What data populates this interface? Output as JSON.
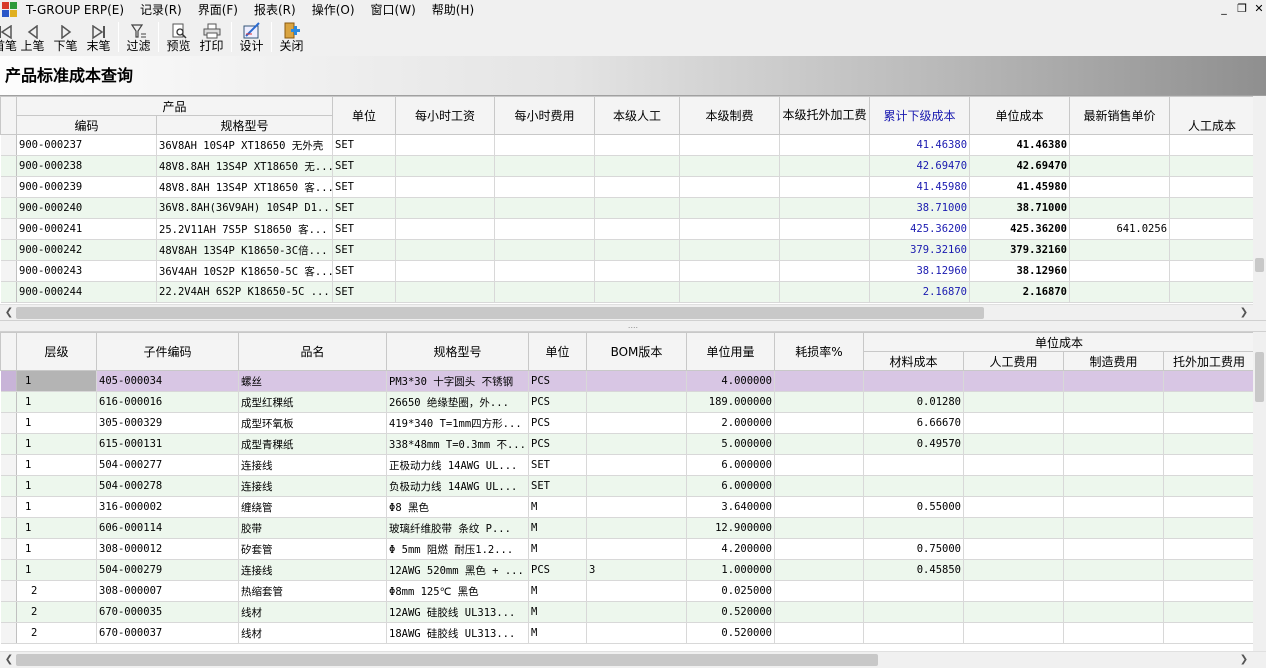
{
  "menubar": {
    "app": "T-GROUP ERP(E)",
    "items": [
      "记录(R)",
      "界面(F)",
      "报表(R)",
      "操作(O)",
      "窗口(W)",
      "帮助(H)"
    ],
    "minimize": "_",
    "restore": "❐",
    "close": "✕"
  },
  "toolbar": {
    "buttons": [
      {
        "label": "首笔",
        "icon": "first-record-icon"
      },
      {
        "label": "上笔",
        "icon": "prev-record-icon"
      },
      {
        "label": "下笔",
        "icon": "next-record-icon"
      },
      {
        "label": "末笔",
        "icon": "last-record-icon"
      },
      {
        "label": "过滤",
        "icon": "filter-icon"
      },
      {
        "label": "预览",
        "icon": "preview-icon"
      },
      {
        "label": "打印",
        "icon": "print-icon"
      },
      {
        "label": "设计",
        "icon": "design-icon"
      },
      {
        "label": "关闭",
        "icon": "close-window-icon"
      }
    ]
  },
  "page": {
    "title": "产品标准成本查询"
  },
  "upper": {
    "group_header": "产品",
    "columns": [
      "编码",
      "规格型号",
      "单位",
      "每小时工资",
      "每小时费用",
      "本级人工",
      "本级制费",
      "本级托外加工费",
      "累计下级成本",
      "单位成本",
      "最新销售单价",
      "人工成本"
    ],
    "rows": [
      [
        "900-000237",
        "36V8AH 10S4P XT18650 无外壳",
        "SET",
        "",
        "",
        "",
        "",
        "",
        "41.46380",
        "41.46380",
        "",
        ""
      ],
      [
        "900-000238",
        "48V8.8AH 13S4P XT18650 无...",
        "SET",
        "",
        "",
        "",
        "",
        "",
        "42.69470",
        "42.69470",
        "",
        ""
      ],
      [
        "900-000239",
        "48V8.8AH 13S4P XT18650 客...",
        "SET",
        "",
        "",
        "",
        "",
        "",
        "41.45980",
        "41.45980",
        "",
        ""
      ],
      [
        "900-000240",
        "36V8.8AH(36V9AH) 10S4P D1...",
        "SET",
        "",
        "",
        "",
        "",
        "",
        "38.71000",
        "38.71000",
        "",
        ""
      ],
      [
        "900-000241",
        "25.2V11AH 7S5P S18650 客...",
        "SET",
        "",
        "",
        "",
        "",
        "",
        "425.36200",
        "425.36200",
        "641.0256",
        ""
      ],
      [
        "900-000242",
        "48V8AH 13S4P K18650-3C倍...",
        "SET",
        "",
        "",
        "",
        "",
        "",
        "379.32160",
        "379.32160",
        "",
        ""
      ],
      [
        "900-000243",
        "36V4AH 10S2P K18650-5C 客...",
        "SET",
        "",
        "",
        "",
        "",
        "",
        "38.12960",
        "38.12960",
        "",
        ""
      ],
      [
        "900-000244",
        "22.2V4AH 6S2P K18650-5C ...",
        "SET",
        "",
        "",
        "",
        "",
        "",
        "2.16870",
        "2.16870",
        "",
        ""
      ]
    ]
  },
  "splitter": "....",
  "lower": {
    "group_header": "单位成本",
    "columns": [
      "层级",
      "子件编码",
      "品名",
      "规格型号",
      "单位",
      "BOM版本",
      "单位用量",
      "耗损率%",
      "材料成本",
      "人工费用",
      "制造费用",
      "托外加工费用"
    ],
    "rows": [
      [
        "1",
        "405-000034",
        "螺丝",
        "PM3*30 十字圆头 不锈钢",
        "PCS",
        "",
        "4.000000",
        "",
        "",
        "",
        "",
        ""
      ],
      [
        "1",
        "616-000016",
        "成型红稞纸",
        "26650 绝缘垫圈，外...",
        "PCS",
        "",
        "189.000000",
        "",
        "0.01280",
        "",
        "",
        ""
      ],
      [
        "1",
        "305-000329",
        "成型环氧板",
        "419*340 T=1mm四方形...",
        "PCS",
        "",
        "2.000000",
        "",
        "6.66670",
        "",
        "",
        ""
      ],
      [
        "1",
        "615-000131",
        "成型青稞纸",
        "338*48mm T=0.3mm 不...",
        "PCS",
        "",
        "5.000000",
        "",
        "0.49570",
        "",
        "",
        ""
      ],
      [
        "1",
        "504-000277",
        "连接线",
        "正极动力线 14AWG UL...",
        "SET",
        "",
        "6.000000",
        "",
        "",
        "",
        "",
        ""
      ],
      [
        "1",
        "504-000278",
        "连接线",
        "负极动力线 14AWG UL...",
        "SET",
        "",
        "6.000000",
        "",
        "",
        "",
        "",
        ""
      ],
      [
        "1",
        "316-000002",
        "缠绕管",
        "Φ8 黑色",
        "M",
        "",
        "3.640000",
        "",
        "0.55000",
        "",
        "",
        ""
      ],
      [
        "1",
        "606-000114",
        "胶带",
        "玻璃纤维胶带 条纹 P...",
        "M",
        "",
        "12.900000",
        "",
        "",
        "",
        "",
        ""
      ],
      [
        "1",
        "308-000012",
        "矽套管",
        "Φ 5mm 阻燃 耐压1.2...",
        "M",
        "",
        "4.200000",
        "",
        "0.75000",
        "",
        "",
        ""
      ],
      [
        "1",
        "504-000279",
        "连接线",
        "12AWG 520mm 黑色 + ...",
        "PCS",
        "3",
        "1.000000",
        "",
        "0.45850",
        "",
        "",
        ""
      ],
      [
        "2",
        "308-000007",
        "热缩套管",
        "Φ8mm 125℃ 黑色",
        "M",
        "",
        "0.025000",
        "",
        "",
        "",
        "",
        ""
      ],
      [
        "2",
        "670-000035",
        "线材",
        "12AWG  硅胶线 UL313...",
        "M",
        "",
        "0.520000",
        "",
        "",
        "",
        "",
        ""
      ],
      [
        "2",
        "670-000037",
        "线材",
        "18AWG  硅胶线 UL313...",
        "M",
        "",
        "0.520000",
        "",
        "",
        "",
        "",
        ""
      ]
    ]
  }
}
